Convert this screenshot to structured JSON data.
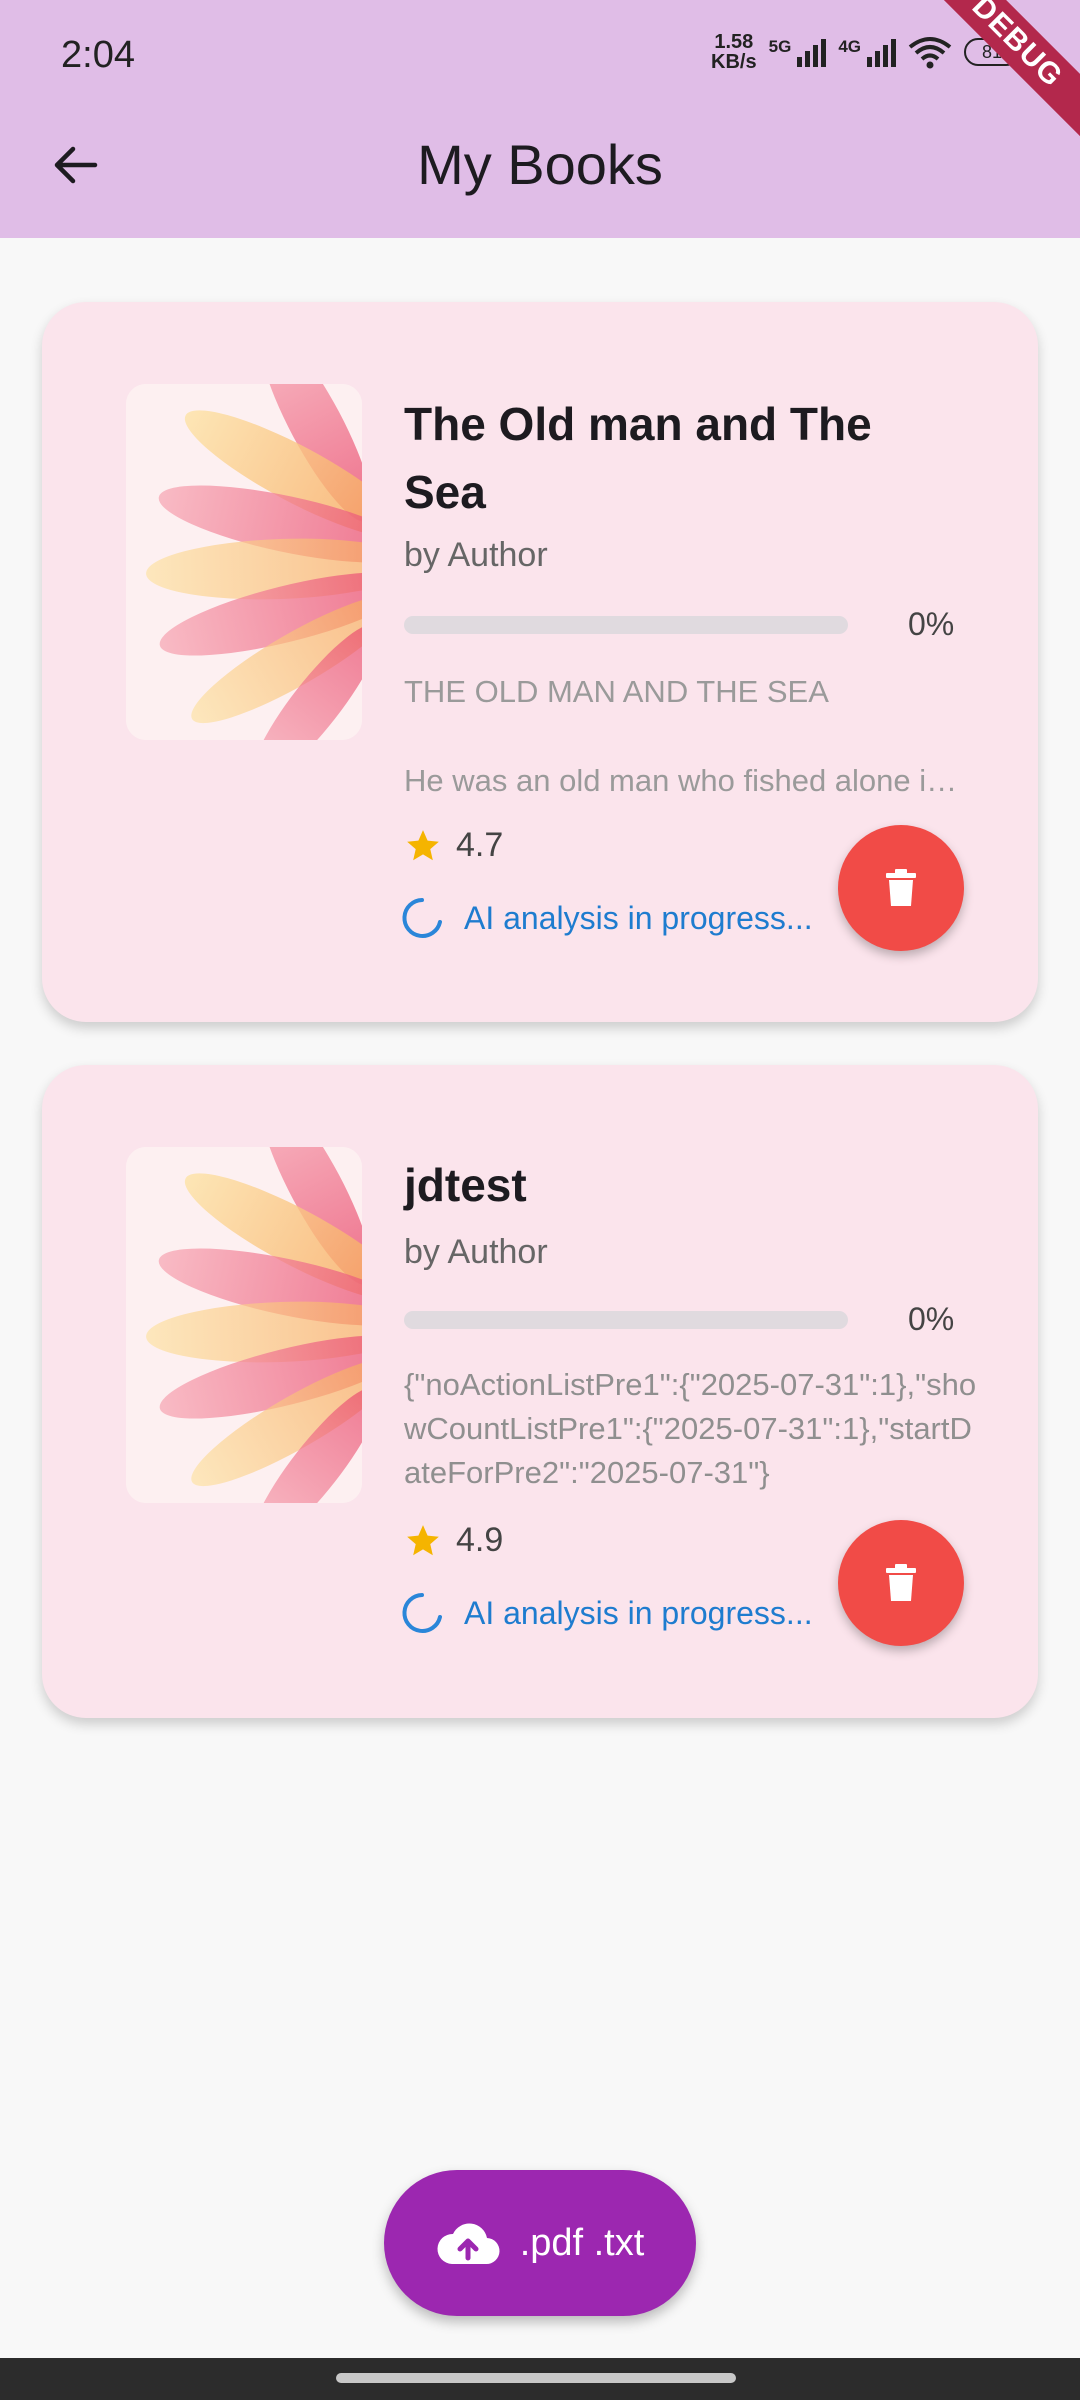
{
  "status_bar": {
    "time": "2:04",
    "net_speed_value": "1.58",
    "net_speed_unit": "KB/s",
    "sim1": "5G",
    "sim2": "4G",
    "battery": "81"
  },
  "debug_banner": "DEBUG",
  "header": {
    "title": "My Books",
    "back_icon": "arrow-left-icon"
  },
  "books": [
    {
      "title": "The Old man and The Sea",
      "author": "by Author",
      "progress_percent": 0,
      "progress_label": "0%",
      "snippet_heading": "THE OLD MAN AND THE SEA",
      "snippet": "He was an old man who fished alone in a skiff in the Gulf Stream",
      "rating": "4.7",
      "ai_status": "AI analysis in progress...",
      "delete_icon": "trash-icon"
    },
    {
      "title": "jdtest",
      "author": "by Author",
      "progress_percent": 0,
      "progress_label": "0%",
      "snippet": "{\"noActionListPre1\":{\"2025-07-31\":1},\"showCountListPre1\":{\"2025-07-31\":1},\"startDateForPre2\":\"2025-07-31\"}",
      "rating": "4.9",
      "ai_status": "AI analysis in progress...",
      "delete_icon": "trash-icon"
    }
  ],
  "upload_button": {
    "label": ".pdf .txt",
    "icon": "cloud-upload-icon"
  },
  "colors": {
    "appbar": "#e0bde7",
    "card": "#fbe4ec",
    "accent": "#9c27b0",
    "delete": "#f14b47",
    "ai_status": "#1e7ccf",
    "star": "#f5b400"
  }
}
